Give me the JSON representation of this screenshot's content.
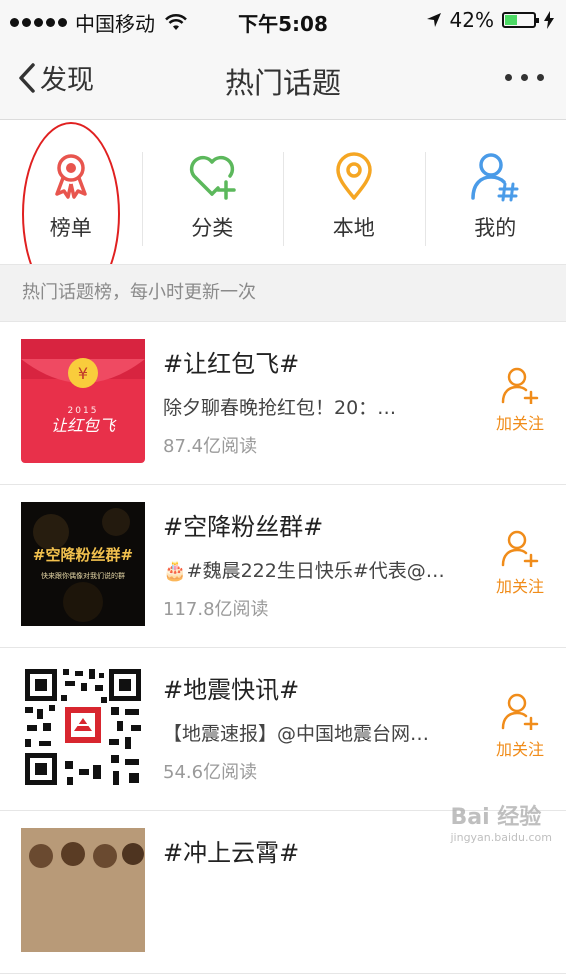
{
  "status_bar": {
    "carrier": "中国移动",
    "time": "下午5:08",
    "battery": "42%",
    "battery_level": 0.42
  },
  "nav": {
    "back_label": "发现",
    "title": "热门话题"
  },
  "categories": [
    {
      "label": "榜单",
      "icon": "ribbon-award-icon",
      "color": "#e8554e"
    },
    {
      "label": "分类",
      "icon": "heart-plus-icon",
      "color": "#5cb85c"
    },
    {
      "label": "本地",
      "icon": "location-pin-icon",
      "color": "#f5a623"
    },
    {
      "label": "我的",
      "icon": "user-hash-icon",
      "color": "#4a9be8"
    }
  ],
  "section_header": "热门话题榜，每小时更新一次",
  "topics": [
    {
      "title": "#让红包飞#",
      "desc": "除夕聊春晚抢红包！20：…",
      "reads": "87.4亿阅读",
      "follow": "加关注",
      "thumb": {
        "year": "2015",
        "text": "让红包飞",
        "currency": "¥"
      }
    },
    {
      "title": "#空降粉丝群#",
      "desc": "🎂#魏晨222生日快乐#代表@…",
      "reads": "117.8亿阅读",
      "follow": "加关注",
      "thumb": {
        "text": "#空降粉丝群#",
        "subtext": "快来跟你偶像对我们说的群"
      }
    },
    {
      "title": "#地震快讯#",
      "desc": "【地震速报】@中国地震台网…",
      "reads": "54.6亿阅读",
      "follow": "加关注",
      "thumb": {}
    },
    {
      "title": "#冲上云霄#",
      "desc": "",
      "reads": "",
      "follow": "",
      "thumb": {}
    }
  ],
  "watermark": {
    "brand": "Bai 经验",
    "url": "jingyan.baidu.com"
  },
  "colors": {
    "accent_orange": "#f08c1a",
    "annotation_red": "#e02020",
    "redpacket": "#e8304a"
  }
}
